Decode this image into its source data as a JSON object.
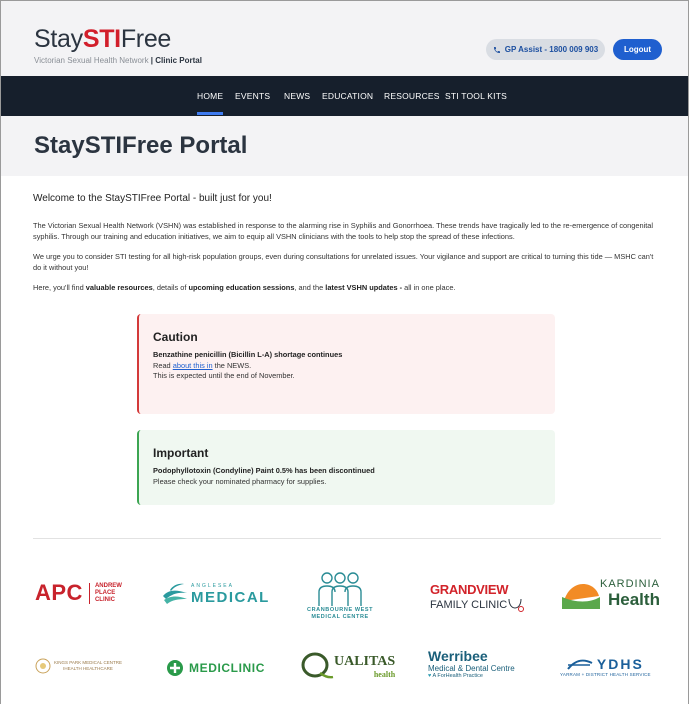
{
  "header": {
    "logo_stay": "Stay",
    "logo_sti": "STI",
    "logo_free": "Free",
    "logo_subtitle_network": "Victorian Sexual Health Network",
    "logo_subtitle_sep": " | ",
    "logo_subtitle_portal": "Clinic Portal",
    "gp_assist_label": "GP Assist - 1800 009 903",
    "logout_label": "Logout"
  },
  "nav": {
    "items": [
      {
        "label": "HOME",
        "active": true
      },
      {
        "label": "EVENTS"
      },
      {
        "label": "NEWS"
      },
      {
        "label": "EDUCATION"
      },
      {
        "label": "RESOURCES"
      },
      {
        "label": "STI TOOL KITS"
      }
    ]
  },
  "page": {
    "title": "StaySTIFree Portal",
    "welcome": "Welcome to the StaySTIFree Portal - built just for you!",
    "para1": "The Victorian Sexual Health Network (VSHN) was established in response to the alarming rise in Syphilis and Gonorrhoea. These trends have tragically led to the re-emergence of congenital syphilis. Through our training and education initiatives, we aim to equip all VSHN clinicians with the tools to help stop the spread of these infections.",
    "para2": "We urge you to consider STI testing for all high-risk population groups, even during consultations for unrelated issues. Your vigilance and support are critical to turning this tide — MSHC can't do it without you!",
    "para3_a": "Here, you'll find ",
    "para3_b": "valuable resources",
    "para3_c": ", details of ",
    "para3_d": "upcoming education sessions",
    "para3_e": ", and the ",
    "para3_f": "latest VSHN updates -",
    "para3_g": " all in one place."
  },
  "alerts": {
    "caution": {
      "title": "Caution",
      "headline": "Benzathine penicillin (Bicillin L-A) shortage continues",
      "line_read": "Read ",
      "link": "about this in",
      "line_news": " the NEWS.",
      "line2": "This is expected until the end of November."
    },
    "important": {
      "title": "Important",
      "headline": "Podophyllotoxin (Condyline) Paint 0.5% has been discontinued",
      "line2": "Please check your nominated pharmacy for supplies."
    }
  },
  "partners": {
    "apc_big": "APC",
    "apc_l1": "ANDREW",
    "apc_l2": "PLACE",
    "apc_l3": "CLINIC",
    "ang_top": "ANGLESEA",
    "ang_name": "MEDICAL",
    "cw_l1": "CRANBOURNE WEST",
    "cw_l2": "MEDICAL CENTRE",
    "gv_top": "GRANDVIEW",
    "gv_bot": "FAMILY CLINIC",
    "kar_top": "KARDINIA",
    "kar_bot": "Health",
    "kp_l1": "KINGS PARK MEDICAL CENTRE",
    "kp_l2": "IHEALTH HEALTHCARE",
    "medi": "MEDICLINIC",
    "qual": "UALITAS",
    "qual_sub": "health",
    "wer_top": "Werribee",
    "wer_mid": "Medical & Dental Centre",
    "wer_bot": "A ForHealth Practice",
    "ydhs_top": "YDHS",
    "ydhs_bot": "YARRAM + DISTRICT HEALTH SERVICE"
  },
  "colors": {
    "nav_bg": "#161f2c",
    "accent_blue": "#1f5fcf",
    "brand_red": "#d21f2b",
    "caution_border": "#d33a3a",
    "important_border": "#3ca552"
  }
}
